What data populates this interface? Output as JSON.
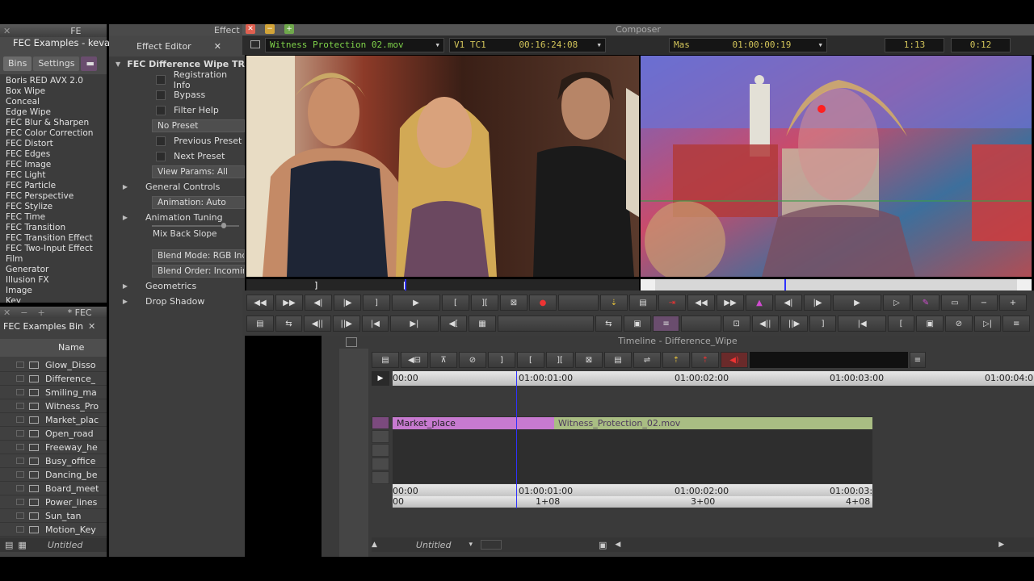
{
  "bins_window": {
    "title": "FEC Examples - kevan",
    "title_short": "FE",
    "tabs": [
      "Bins",
      "Settings"
    ]
  },
  "effect_list": [
    "Boris RED AVX 2.0",
    "Box Wipe",
    "Conceal",
    "Edge Wipe",
    "FEC Blur & Sharpen",
    "FEC Color Correction",
    "FEC Distort",
    "FEC Edges",
    "FEC Image",
    "FEC Light",
    "FEC Particle",
    "FEC Perspective",
    "FEC Stylize",
    "FEC Time",
    "FEC Transition",
    "FEC Transition Effect",
    "FEC Two-Input Effect",
    "Film",
    "Generator",
    "Illusion FX",
    "Image",
    "Key"
  ],
  "fx_bin": {
    "title": "FEC Examples Bin",
    "title_short": "* FEC",
    "column_header": "Name",
    "items": [
      "Glow_Disso",
      "Difference_",
      "Smiling_ma",
      "Witness_Pro",
      "Market_plac",
      "Open_road",
      "Freeway_he",
      "Busy_office",
      "Dancing_be",
      "Board_meet",
      "Power_lines",
      "Sun_tan",
      "Motion_Key"
    ],
    "footer_label": "Untitled"
  },
  "effect_editor": {
    "title": "Effect Editor",
    "title_short": "Effect",
    "effect_name": "FEC Difference Wipe TR",
    "checks": [
      "Registration Info",
      "Bypass",
      "Filter Help"
    ],
    "preset": "No Preset",
    "preset_checks": [
      "Previous Preset",
      "Next Preset"
    ],
    "view_params": "View Params: All",
    "general_controls": "General Controls",
    "animation": "Animation: Auto",
    "animation_tuning": "Animation Tuning",
    "mix_back_slope": "Mix Back Slope",
    "blend_mode": "Blend Mode: RGB Inde",
    "blend_order": "Blend Order: Incomin",
    "geometrics": "Geometrics",
    "drop_shadow": "Drop Shadow"
  },
  "composer": {
    "title": "Composer",
    "clip_name": "Witness Protection 02.mov",
    "track": "V1",
    "tc_label": "TC1",
    "tc_value": "00:16:24:08",
    "mas_label": "Mas",
    "mas_value": "01:00:00:19",
    "counter_a": "1:13",
    "counter_b": "0:12"
  },
  "timeline": {
    "title": "Timeline - Difference_Wipe",
    "ruler_labels": [
      "00:00",
      "01:00:01:00",
      "01:00:02:00",
      "01:00:03:00",
      "01:00:04:0"
    ],
    "clip_a": "Market_place",
    "clip_b": "Witness_Protection_02.mov",
    "bottom_ruler_labels": [
      "00:00",
      "01:00:01:00",
      "01:00:02:00",
      "01:00:03:"
    ],
    "frame_labels": [
      "00",
      "1+08",
      "3+00",
      "4+08"
    ],
    "footer_label": "Untitled"
  },
  "colors": {
    "clip_purple": "#c77ad0",
    "clip_green": "#a9bd83",
    "lcd_text": "#d3c55a",
    "playhead": "#2e31ff"
  }
}
